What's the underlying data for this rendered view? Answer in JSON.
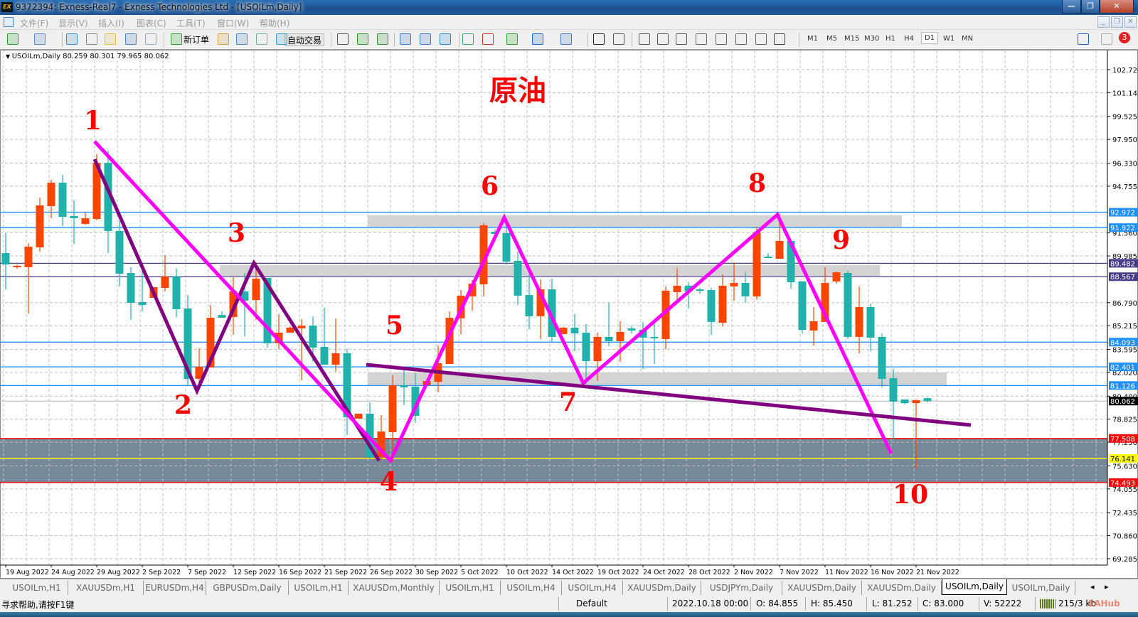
{
  "window": {
    "title": "9372394: Exness-Real7 - Exness Technologies Ltd - [USOILm,Daily]",
    "logo": "EX",
    "minimize": "—",
    "restore": "❐",
    "close": "✕"
  },
  "menu": [
    "文件(F)",
    "显示(V)",
    "插入(I)",
    "图表(C)",
    "工具(T)",
    "窗口(W)",
    "帮助(H)"
  ],
  "toolbar": {
    "new_order": "新订单",
    "auto_trading": "自动交易",
    "timeframes": [
      "M1",
      "M5",
      "M15",
      "M30",
      "H1",
      "H4",
      "D1",
      "W1",
      "MN"
    ],
    "active_timeframe": "D1",
    "notifications": "3",
    "icons": [
      "new-chart-icon",
      "profiles-icon",
      "market-watch-icon",
      "navigator-icon",
      "favorites-icon",
      "terminal-icon",
      "strategy-tester-icon",
      "new-order-icon",
      "metaeditor-icon",
      "signals-icon",
      "vps-icon",
      "auto-trading-icon",
      "bar-chart-icon",
      "candlestick-icon",
      "line-chart-icon",
      "zoom-in-icon",
      "zoom-out-icon",
      "tile-windows-icon",
      "chart-shift-icon",
      "autoscroll-icon",
      "indicators-icon",
      "periods-icon",
      "templates-icon",
      "cursor-icon",
      "crosshair-icon",
      "vertical-line-icon",
      "horizontal-line-icon",
      "trendline-icon",
      "equidistant-channel-icon",
      "fibonacci-icon",
      "text-icon",
      "text-label-icon",
      "arrows-icon",
      "search-icon",
      "chat-icon"
    ]
  },
  "chart_header": "USOILm,Daily  80.259 80.301 79.965 80.062",
  "chart_data": {
    "type": "candlestick",
    "symbol": "USOILm",
    "timeframe": "Daily",
    "ylim": [
      69.285,
      102.72
    ],
    "y_ticks": [
      "102.720",
      "101.145",
      "99.525",
      "97.950",
      "96.330",
      "94.755",
      "91.560",
      "89.985",
      "86.790",
      "85.215",
      "83.595",
      "82.020",
      "80.400",
      "78.825",
      "77.250",
      "75.630",
      "74.055",
      "72.435",
      "70.860",
      "69.285"
    ],
    "x_ticks": [
      "19 Aug 2022",
      "24 Aug 2022",
      "29 Aug 2022",
      "2 Sep 2022",
      "7 Sep 2022",
      "12 Sep 2022",
      "16 Sep 2022",
      "21 Sep 2022",
      "26 Sep 2022",
      "30 Sep 2022",
      "5 Oct 2022",
      "10 Oct 2022",
      "14 Oct 2022",
      "19 Oct 2022",
      "24 Oct 2022",
      "28 Oct 2022",
      "2 Nov 2022",
      "7 Nov 2022",
      "11 Nov 2022",
      "16 Nov 2022",
      "21 Nov 2022"
    ],
    "candles_ohlc": [
      [
        90.18,
        91.54,
        87.7,
        89.4
      ],
      [
        89.21,
        89.4,
        89.11,
        89.31
      ],
      [
        89.21,
        90.86,
        86.05,
        90.62
      ],
      [
        90.57,
        93.97,
        90.28,
        93.44
      ],
      [
        93.39,
        95.19,
        92.56,
        94.99
      ],
      [
        94.99,
        95.53,
        92.03,
        92.66
      ],
      [
        92.71,
        93.78,
        90.81,
        92.56
      ],
      [
        92.17,
        92.95,
        92.13,
        92.56
      ],
      [
        92.51,
        96.94,
        92.42,
        96.35
      ],
      [
        96.35,
        97.18,
        90.18,
        91.69
      ],
      [
        91.69,
        92.37,
        87.9,
        88.77
      ],
      [
        88.82,
        89.21,
        85.61,
        86.78
      ],
      [
        86.83,
        89.02,
        86.2,
        86.63
      ],
      [
        87.12,
        87.85,
        87.12,
        87.85
      ],
      [
        87.8,
        90.04,
        87.56,
        88.58
      ],
      [
        88.58,
        89.11,
        85.81,
        86.34
      ],
      [
        86.39,
        87.31,
        81.09,
        81.58
      ],
      [
        81.58,
        83.67,
        81.09,
        82.41
      ],
      [
        82.36,
        86.63,
        82.36,
        85.76
      ],
      [
        85.95,
        86.2,
        85.76,
        85.76
      ],
      [
        85.81,
        88.58,
        84.59,
        87.56
      ],
      [
        87.56,
        88.82,
        84.49,
        86.93
      ],
      [
        86.97,
        89.55,
        85.61,
        88.43
      ],
      [
        88.48,
        88.48,
        83.72,
        84.01
      ],
      [
        84.01,
        86.0,
        83.62,
        84.74
      ],
      [
        84.74,
        85.17,
        84.74,
        85.08
      ],
      [
        85.03,
        85.66,
        81.48,
        85.22
      ],
      [
        85.22,
        85.86,
        82.75,
        83.72
      ],
      [
        83.77,
        86.44,
        82.55,
        82.55
      ],
      [
        82.55,
        85.71,
        82.07,
        83.33
      ],
      [
        83.33,
        83.62,
        77.74,
        78.96
      ],
      [
        78.86,
        79.2,
        78.86,
        79.2
      ],
      [
        79.2,
        79.97,
        76.14,
        76.23
      ],
      [
        76.23,
        79.1,
        76.04,
        77.98
      ],
      [
        77.93,
        81.82,
        75.89,
        81.14
      ],
      [
        81.14,
        82.21,
        79.78,
        81.0
      ],
      [
        81.05,
        81.97,
        78.57,
        79.05
      ],
      [
        81.14,
        81.58,
        81.14,
        81.43
      ],
      [
        81.38,
        83.86,
        80.66,
        82.65
      ],
      [
        82.6,
        86.2,
        82.6,
        85.76
      ],
      [
        85.71,
        87.65,
        84.64,
        87.27
      ],
      [
        87.22,
        88.33,
        86.24,
        88.09
      ],
      [
        88.04,
        92.22,
        87.22,
        92.08
      ],
      [
        91.64,
        91.79,
        91.3,
        91.49
      ],
      [
        91.54,
        92.56,
        89.4,
        89.6
      ],
      [
        89.65,
        90.28,
        86.63,
        87.27
      ],
      [
        87.31,
        88.72,
        84.98,
        85.86
      ],
      [
        85.86,
        88.38,
        84.3,
        87.7
      ],
      [
        87.7,
        88.43,
        84.06,
        84.45
      ],
      [
        84.64,
        85.13,
        84.64,
        85.08
      ],
      [
        85.08,
        86.0,
        83.47,
        84.69
      ],
      [
        84.74,
        85.32,
        81.24,
        82.79
      ],
      [
        82.79,
        84.74,
        81.43,
        84.45
      ],
      [
        84.45,
        86.78,
        83.81,
        84.16
      ],
      [
        84.16,
        85.52,
        82.75,
        84.79
      ],
      [
        85.03,
        85.22,
        84.69,
        84.88
      ],
      [
        84.93,
        85.47,
        82.26,
        84.4
      ],
      [
        84.45,
        85.56,
        82.6,
        84.35
      ],
      [
        84.3,
        87.9,
        83.62,
        87.61
      ],
      [
        87.51,
        89.16,
        86.73,
        87.95
      ],
      [
        87.95,
        88.19,
        86.39,
        87.56
      ],
      [
        87.7,
        87.8,
        87.41,
        87.61
      ],
      [
        87.65,
        87.8,
        84.59,
        85.47
      ],
      [
        85.42,
        88.72,
        85.17,
        87.95
      ],
      [
        87.9,
        89.55,
        86.93,
        88.14
      ],
      [
        88.14,
        88.87,
        86.78,
        87.22
      ],
      [
        87.22,
        91.98,
        87.02,
        91.59
      ],
      [
        89.94,
        90.18,
        89.84,
        89.84
      ],
      [
        89.79,
        92.85,
        89.79,
        91.01
      ],
      [
        91.01,
        91.01,
        87.75,
        88.19
      ],
      [
        88.24,
        88.24,
        84.69,
        84.93
      ],
      [
        84.88,
        86.49,
        83.86,
        85.52
      ],
      [
        85.47,
        89.21,
        85.47,
        88.14
      ],
      [
        88.24,
        88.92,
        88.09,
        88.87
      ],
      [
        88.82,
        88.97,
        84.3,
        84.45
      ],
      [
        84.45,
        87.9,
        83.33,
        86.49
      ],
      [
        86.49,
        86.73,
        83.47,
        84.4
      ],
      [
        84.45,
        84.69,
        80.99,
        81.58
      ],
      [
        81.63,
        82.26,
        77.35,
        80.02
      ],
      [
        80.17,
        80.17,
        79.83,
        79.92
      ],
      [
        79.92,
        80.17,
        75.41,
        80.12
      ],
      [
        80.259,
        80.301,
        79.965,
        80.062
      ]
    ],
    "bull_color": "#ff4500",
    "bear_color": "#20b2aa",
    "levels": [
      {
        "price": 92.972,
        "label": "92.972",
        "color": "#1e90ff",
        "text": "#ffffff"
      },
      {
        "price": 91.922,
        "label": "91.922",
        "color": "#1e90ff",
        "text": "#ffffff"
      },
      {
        "price": 89.482,
        "label": "89.482",
        "color": "#483d8b",
        "text": "#ffffff"
      },
      {
        "price": 88.567,
        "label": "88.567",
        "color": "#483d8b",
        "text": "#ffffff"
      },
      {
        "price": 84.093,
        "label": "84.093",
        "color": "#1e90ff",
        "text": "#ffffff"
      },
      {
        "price": 82.401,
        "label": "82.401",
        "color": "#1e90ff",
        "text": "#ffffff"
      },
      {
        "price": 81.126,
        "label": "81.126",
        "color": "#1e90ff",
        "text": "#ffffff"
      },
      {
        "price": 80.062,
        "label": "80.062",
        "color": "#c0c0c0",
        "text": "#ffffff",
        "box": "#000000"
      },
      {
        "price": 77.508,
        "label": "77.508",
        "color": "#ff0000",
        "text": "#ffffff"
      },
      {
        "price": 76.141,
        "label": "76.141",
        "color": "#ffff00",
        "text": "#000000"
      },
      {
        "price": 74.493,
        "label": "74.493",
        "color": "#ff0000",
        "text": "#ffffff"
      }
    ],
    "support_zone": {
      "from": 74.493,
      "to": 77.508,
      "color": "#778899"
    },
    "gray_zones": [
      {
        "from": 91.98,
        "to": 92.76
      },
      {
        "from": 88.63,
        "to": 89.35
      },
      {
        "from": 81.14,
        "to": 82.02
      }
    ],
    "annotations": {
      "title": "原油",
      "points": [
        "1",
        "2",
        "3",
        "4",
        "5",
        "6",
        "7",
        "8",
        "9",
        "10"
      ]
    }
  },
  "tabs": [
    "USOILm,H1",
    "XAUUSDm,H1",
    "EURUSDm,H4",
    "GBPUSDm,Daily",
    "USOILm,H1",
    "XAUUSDm,Monthly",
    "USOILm,H1",
    "USOILm,H4",
    "USOILm,H4",
    "XAUUSDm,Daily",
    "USDJPYm,Daily",
    "XAUUSDm,Daily",
    "XAUUSDm,Daily",
    "USOILm,Daily",
    "USOILm,Daily"
  ],
  "active_tab": 13,
  "tab_scroll": {
    "left": "◂",
    "right": "▸"
  },
  "status": {
    "help": "寻求帮助,请按F1键",
    "profile": "Default",
    "datetime": "2022.10.18 00:00",
    "open": "O: 84.855",
    "high": "H: 85.450",
    "low": "L: 81.252",
    "close": "C: 83.000",
    "volume": "V: 52222",
    "traffic": "215/3 kb",
    "watermark": "EAHub"
  }
}
